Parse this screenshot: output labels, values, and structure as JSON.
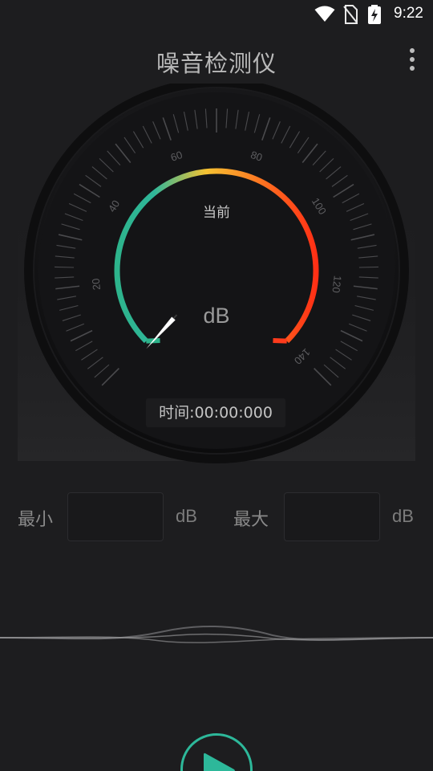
{
  "status_bar": {
    "time": "9:22",
    "icons": [
      "wifi-icon",
      "no-sim-icon",
      "battery-charging-icon"
    ]
  },
  "header": {
    "title": "噪音检测仪",
    "menu_icon": "more-vert-icon"
  },
  "gauge": {
    "current_label": "当前",
    "unit": "dB",
    "scale_labels": [
      "20",
      "40",
      "60",
      "80",
      "100",
      "120",
      "140"
    ],
    "needle_value": 0,
    "timer_label": "时间:",
    "timer_value": "00:00:000",
    "colors": {
      "low": "#2db38a",
      "mid": "#f5c232",
      "high": "#ff3b1c"
    }
  },
  "stats": {
    "min_label": "最小",
    "min_value": "",
    "max_label": "最大",
    "max_value": "",
    "unit": "dB"
  },
  "controls": {
    "play_icon": "play-icon",
    "accent": "#2db89a"
  }
}
